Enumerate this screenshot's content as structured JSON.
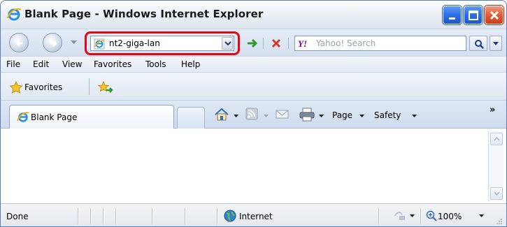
{
  "window": {
    "title": "Blank Page - Windows Internet Explorer"
  },
  "address_bar": {
    "url": "nt2-giga-lan"
  },
  "search": {
    "placeholder": "Yahoo! Search",
    "provider": "Yahoo!"
  },
  "menu": {
    "items": [
      "File",
      "Edit",
      "View",
      "Favorites",
      "Tools",
      "Help"
    ]
  },
  "favorites_bar": {
    "label": "Favorites"
  },
  "tabs": {
    "active_label": "Blank Page"
  },
  "command_bar": {
    "page_label": "Page",
    "safety_label": "Safety",
    "overflow": "»"
  },
  "status_bar": {
    "status": "Done",
    "zone": "Internet",
    "zoom": "100%"
  },
  "colors": {
    "highlight": "#e30613",
    "close_button": "#d84a24",
    "window_button": "#2c6fe6"
  },
  "icons": [
    "ie-logo-icon",
    "back-arrow-icon",
    "forward-arrow-icon",
    "dropdown-icon",
    "refresh-go-icon",
    "stop-icon",
    "yahoo-icon",
    "search-icon",
    "star-icon",
    "add-favorite-icon",
    "home-icon",
    "rss-feed-icon",
    "mail-icon",
    "print-icon",
    "globe-icon",
    "protected-mode-icon",
    "zoom-icon"
  ]
}
